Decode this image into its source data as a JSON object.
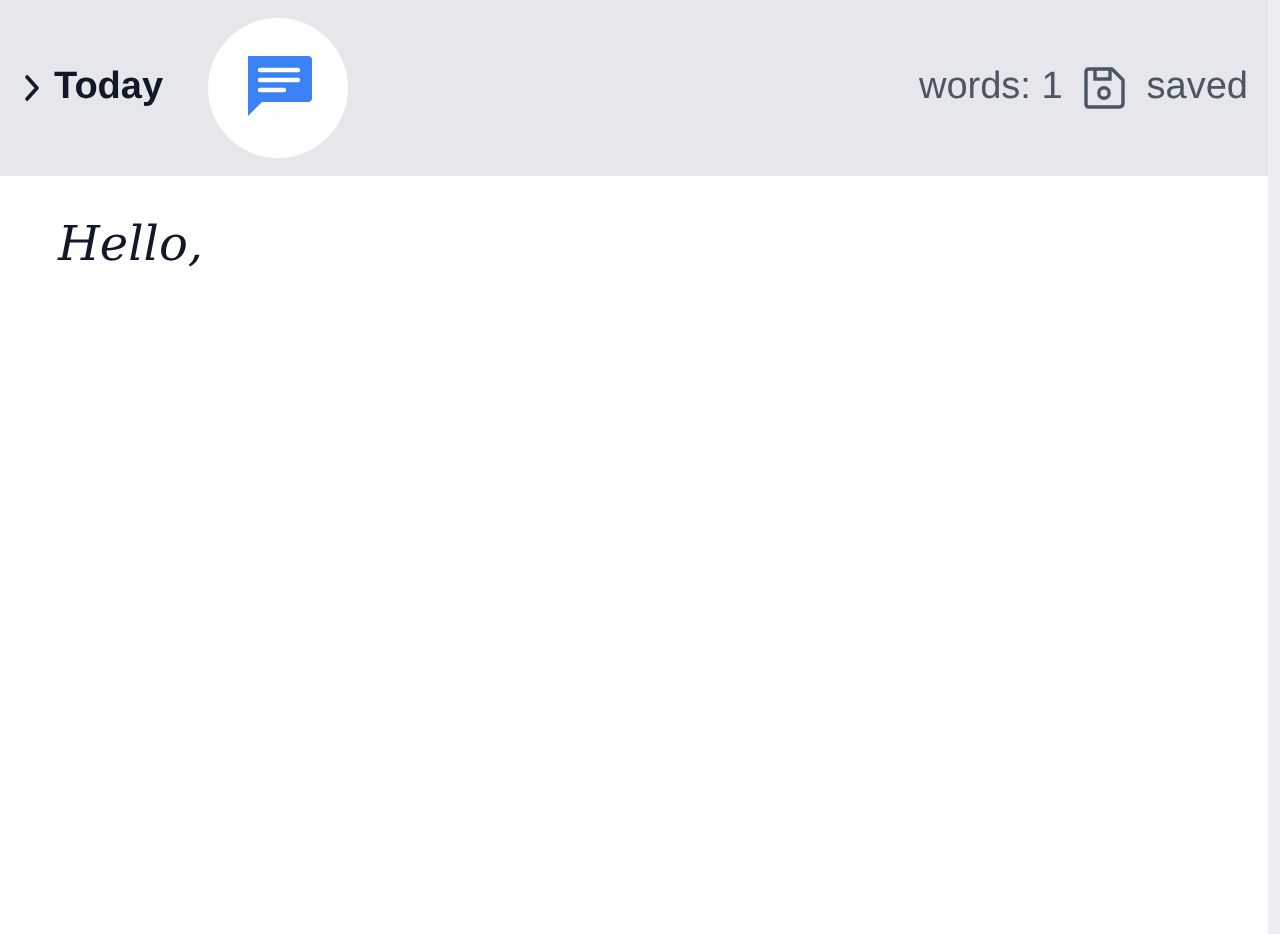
{
  "header": {
    "title": "Today",
    "word_count": "words: 1",
    "save_status": "saved"
  },
  "editor": {
    "text": "Hello,"
  }
}
